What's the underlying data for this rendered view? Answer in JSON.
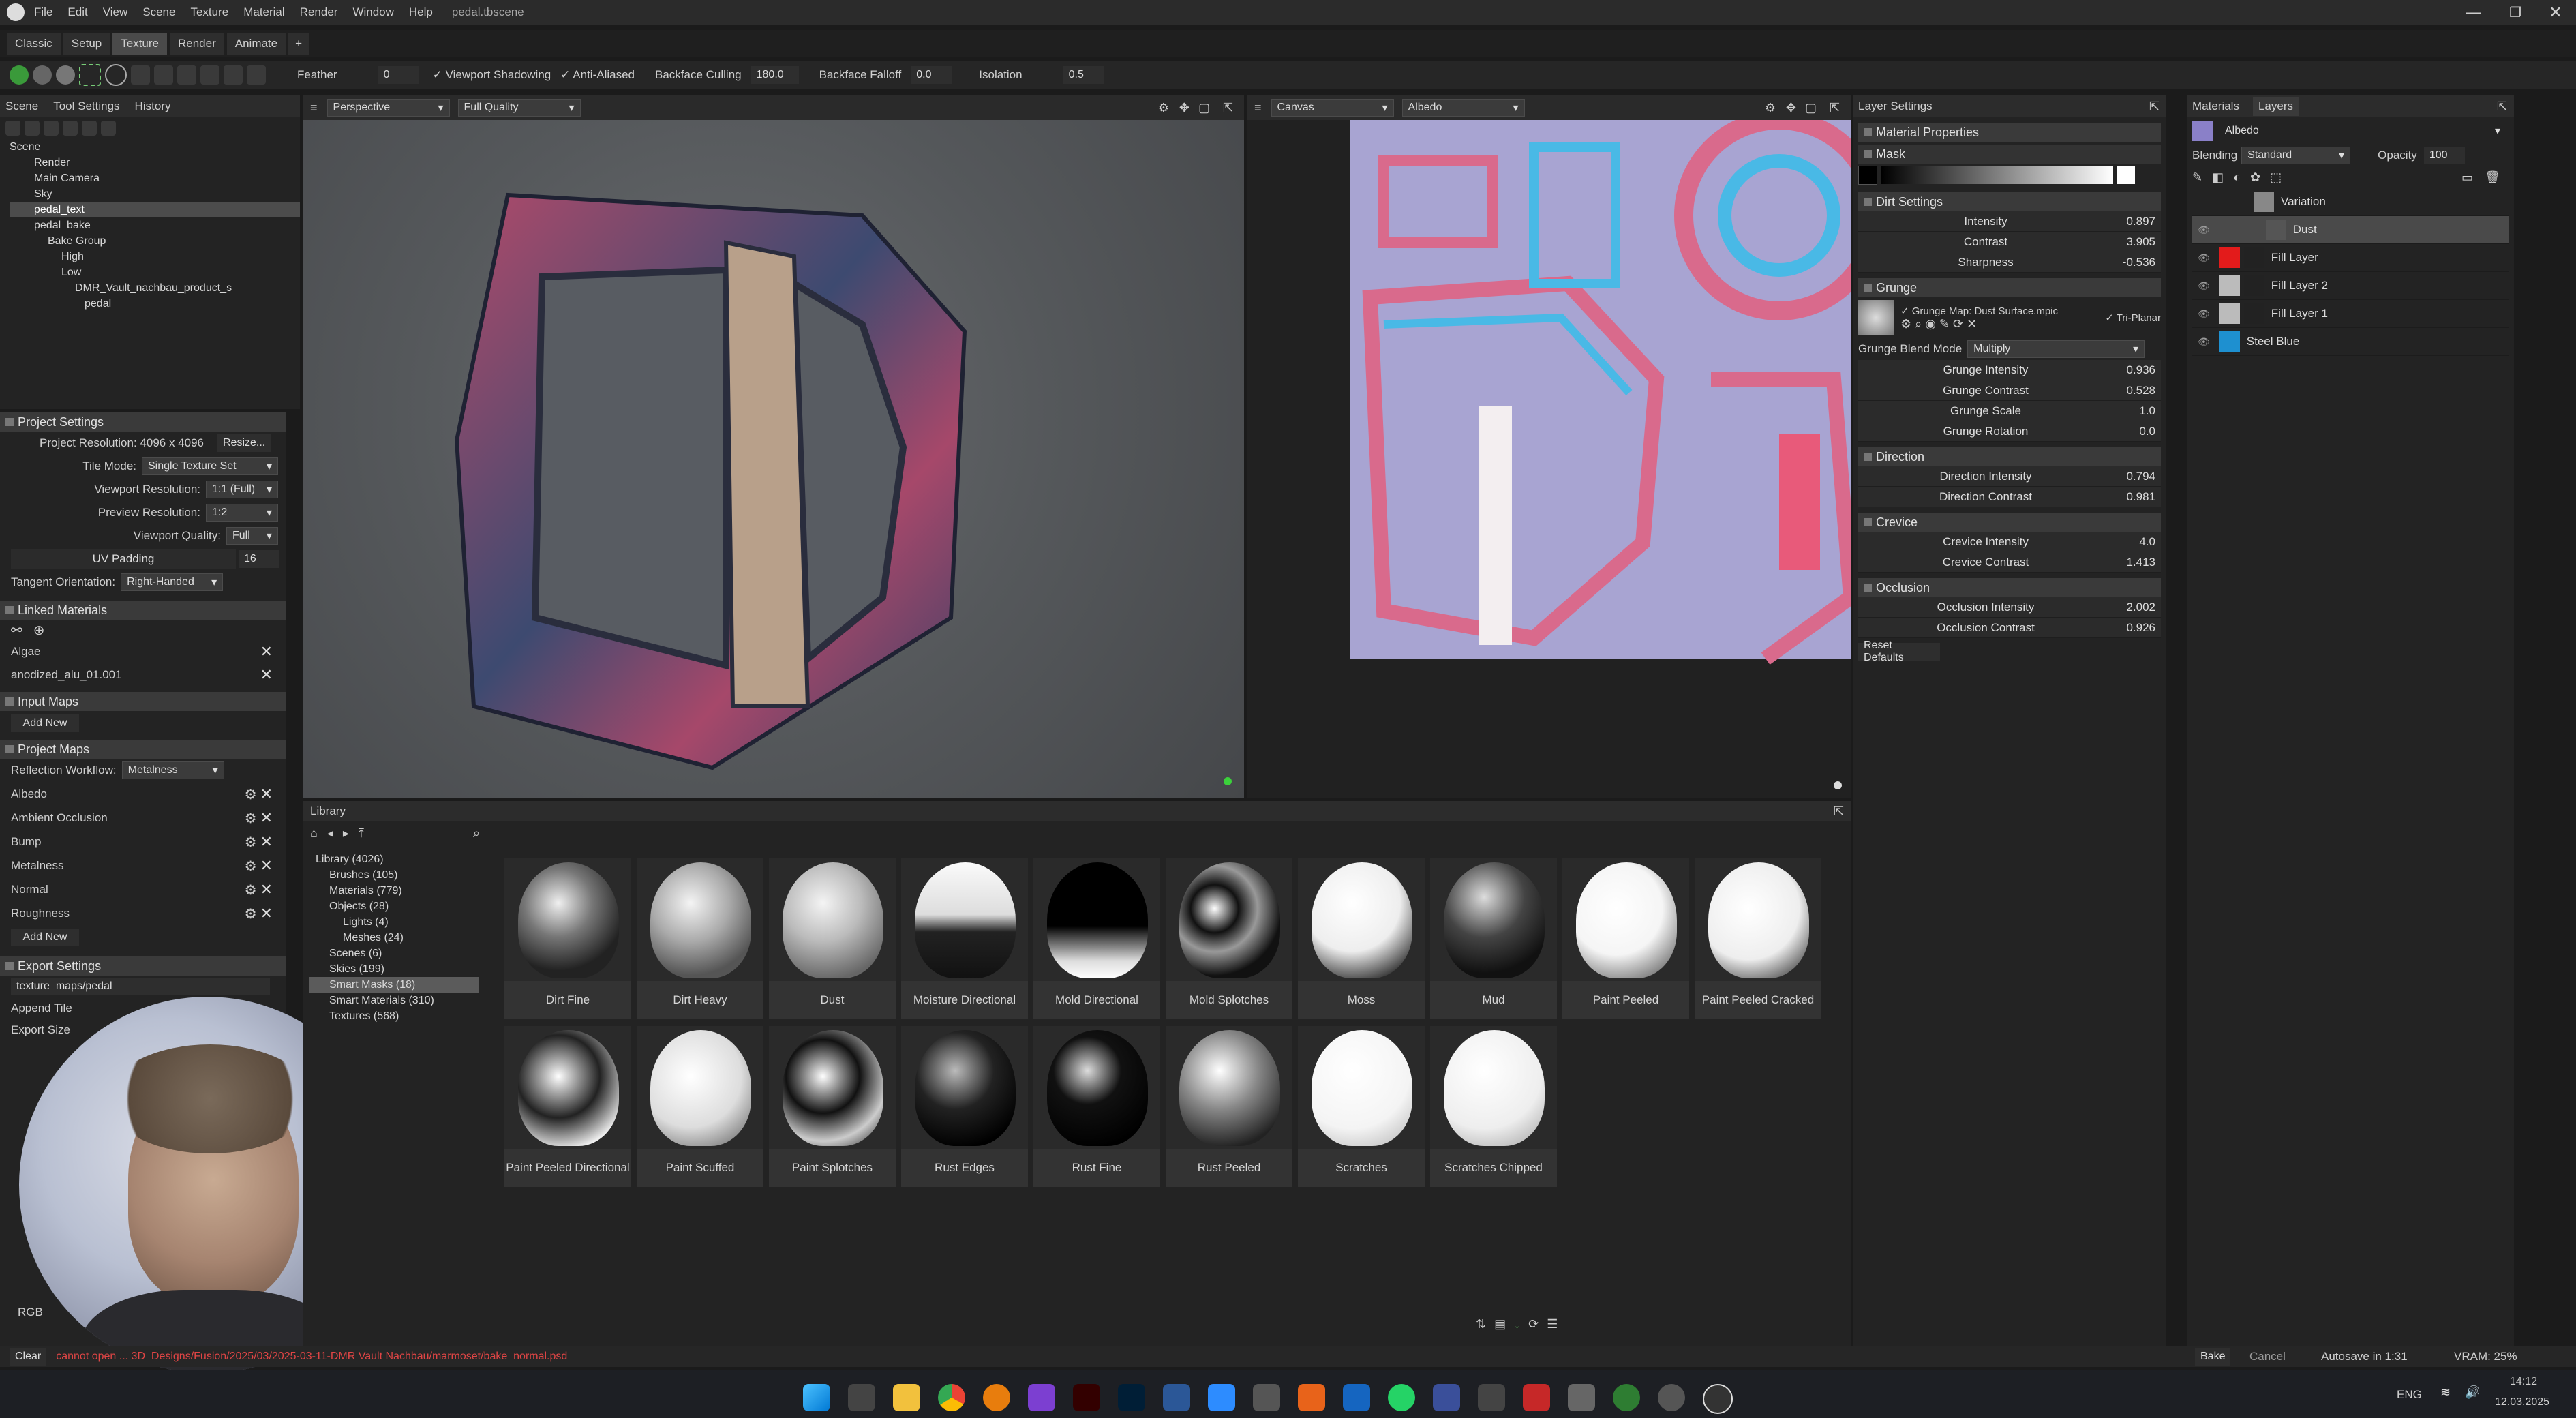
{
  "menu": {
    "items": [
      "File",
      "Edit",
      "View",
      "Scene",
      "Texture",
      "Material",
      "Render",
      "Window",
      "Help"
    ],
    "doc_title": "pedal.tbscene"
  },
  "workspace_tabs": [
    "Classic",
    "Setup",
    "Texture",
    "Render",
    "Animate",
    "+"
  ],
  "toolbar": {
    "feather_label": "Feather",
    "feather_value": "0",
    "viewport_shadowing": "Viewport Shadowing",
    "anti_aliased": "Anti-Aliased",
    "backface_culling": "Backface Culling",
    "backface_culling_value": "180.0",
    "backface_falloff": "Backface Falloff",
    "backface_falloff_value": "0.0",
    "isolation": "Isolation",
    "isolation_value": "0.5"
  },
  "scene_panel": {
    "tabs": [
      "Scene",
      "Tool Settings",
      "History"
    ],
    "tree": [
      "Scene",
      "Render",
      "Main Camera",
      "Sky",
      "pedal_text",
      "pedal_bake",
      "Bake Group",
      "High",
      "Low",
      "DMR_Vault_nachbau_product_s",
      "pedal"
    ]
  },
  "project_settings": {
    "title": "Project Settings",
    "resolution_label": "Project Resolution: 4096 x 4096",
    "resize": "Resize...",
    "tile_mode_label": "Tile Mode:",
    "tile_mode": "Single Texture Set",
    "viewport_res_label": "Viewport Resolution:",
    "viewport_res": "1:1 (Full)",
    "preview_res_label": "Preview Resolution:",
    "preview_res": "1:2",
    "viewport_quality_label": "Viewport Quality:",
    "viewport_quality": "Full",
    "uv_padding_label": "UV Padding",
    "uv_padding": "16",
    "tangent_label": "Tangent Orientation:",
    "tangent": "Right-Handed"
  },
  "linked_materials": {
    "title": "Linked Materials",
    "items": [
      "Algae",
      "anodized_alu_01.001"
    ]
  },
  "input_maps": {
    "title": "Input Maps",
    "add_new": "Add New"
  },
  "project_maps": {
    "title": "Project Maps",
    "reflection_label": "Reflection Workflow:",
    "reflection": "Metalness",
    "maps": [
      "Albedo",
      "Ambient Occlusion",
      "Bump",
      "Metalness",
      "Normal",
      "Roughness"
    ],
    "add_new": "Add New"
  },
  "export_settings": {
    "title": "Export Settings",
    "path": "texture_maps/pedal",
    "append_tile": "Append Tile",
    "export_size": "Export Size",
    "rgb": "RGB"
  },
  "viewport": {
    "projection": "Perspective",
    "quality": "Full Quality"
  },
  "canvas": {
    "mode": "Canvas",
    "channel": "Albedo"
  },
  "library": {
    "title": "Library",
    "tree": [
      "Library (4026)",
      "Brushes (105)",
      "Materials (779)",
      "Objects (28)",
      "Lights (4)",
      "Meshes (24)",
      "Scenes (6)",
      "Skies (199)",
      "Smart Masks (18)",
      "Smart Materials (310)",
      "Textures (568)"
    ],
    "items": [
      "Dirt Fine",
      "Dirt Heavy",
      "Dust",
      "Moisture Directional",
      "Mold Directional",
      "Mold Splotches",
      "Moss",
      "Mud",
      "Paint Peeled",
      "Paint Peeled Cracked",
      "Paint Peeled Directional",
      "Paint Scuffed",
      "Paint Splotches",
      "Rust Edges",
      "Rust Fine",
      "Rust Peeled",
      "Scratches",
      "Scratches Chipped"
    ]
  },
  "layer_settings": {
    "title": "Layer Settings",
    "material_properties": "Material Properties",
    "mask": "Mask",
    "dirt_settings": "Dirt Settings",
    "intensity": {
      "label": "Intensity",
      "value": "0.897"
    },
    "contrast": {
      "label": "Contrast",
      "value": "3.905"
    },
    "sharpness": {
      "label": "Sharpness",
      "value": "-0.536"
    },
    "grunge": "Grunge",
    "grunge_map": "Grunge Map: Dust Surface.mpic",
    "tri_planar": "Tri-Planar",
    "grunge_blend_label": "Grunge Blend Mode",
    "grunge_blend": "Multiply",
    "grunge_intensity": {
      "label": "Grunge Intensity",
      "value": "0.936"
    },
    "grunge_contrast": {
      "label": "Grunge Contrast",
      "value": "0.528"
    },
    "grunge_scale": {
      "label": "Grunge Scale",
      "value": "1.0"
    },
    "grunge_rotation": {
      "label": "Grunge Rotation",
      "value": "0.0"
    },
    "direction": "Direction",
    "direction_intensity": {
      "label": "Direction Intensity",
      "value": "0.794"
    },
    "direction_contrast": {
      "label": "Direction Contrast",
      "value": "0.981"
    },
    "crevice": "Crevice",
    "crevice_intensity": {
      "label": "Crevice Intensity",
      "value": "4.0"
    },
    "crevice_contrast": {
      "label": "Crevice Contrast",
      "value": "1.413"
    },
    "occlusion": "Occlusion",
    "occlusion_intensity": {
      "label": "Occlusion Intensity",
      "value": "2.002"
    },
    "occlusion_contrast": {
      "label": "Occlusion Contrast",
      "value": "0.926"
    },
    "reset_defaults": "Reset Defaults"
  },
  "layers_panel": {
    "tabs": [
      "Materials",
      "Layers"
    ],
    "channel": "Albedo",
    "blending_label": "Blending",
    "blending": "Standard",
    "opacity_label": "Opacity",
    "opacity": "100",
    "layers": [
      "Variation",
      "Dust",
      "Fill Layer",
      "Fill Layer 2",
      "Fill Layer 1",
      "Steel Blue"
    ]
  },
  "status": {
    "clear": "Clear",
    "error": "cannot open ... 3D_Designs/Fusion/2025/03/2025-03-11-DMR Vault Nachbau/marmoset/bake_normal.psd",
    "bake": "Bake",
    "cancel": "Cancel",
    "autosave": "Autosave in 1:31",
    "vram": "VRAM: 25%"
  },
  "taskbar": {
    "lang": "ENG",
    "time": "14:12",
    "date": "12.03.2025"
  },
  "colors": {
    "accent": "#3a8fd8",
    "fill_red": "#e31b1b",
    "steel_blue": "#1e90d0",
    "selection": "#5a5a5a"
  }
}
